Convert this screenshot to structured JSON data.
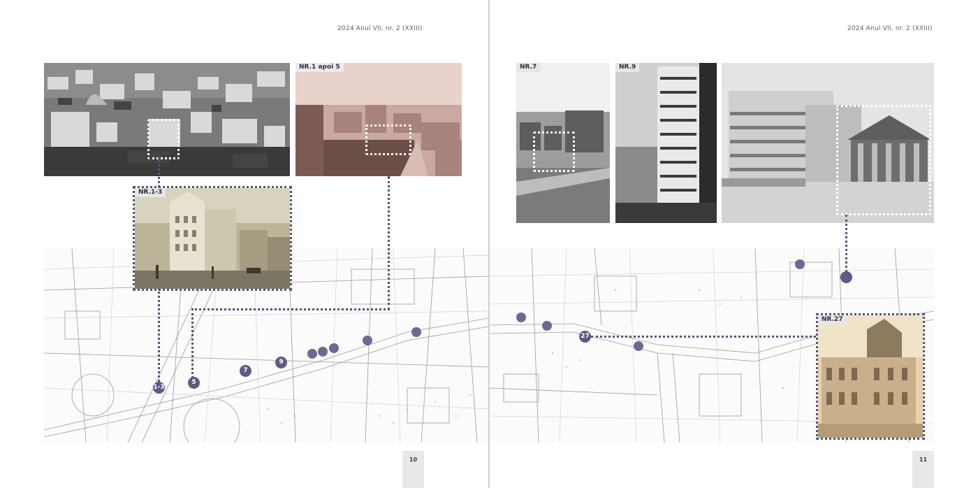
{
  "left_page": {
    "header": "2024 Anul VII, nr. 2 (XXIII)",
    "page_number": "10",
    "photo_labels": {
      "nr1_then5": "NR.1 apoi 5",
      "nr1_3": "NR.1-3"
    },
    "map_markers": [
      "1-3",
      "5",
      "7",
      "9"
    ]
  },
  "right_page": {
    "header": "2024 Anul VII, nr. 2 (XXIII)",
    "page_number": "11",
    "photo_labels": {
      "nr7": "NR.7",
      "nr9": "NR.9",
      "nr27": "NR.27"
    },
    "map_markers": [
      "27"
    ]
  },
  "colors": {
    "accent": "#5c5b85",
    "header_text": "#5a5e78",
    "tag_bg": "#e6e6e6",
    "pageno_bg": "#e8e8e8"
  }
}
